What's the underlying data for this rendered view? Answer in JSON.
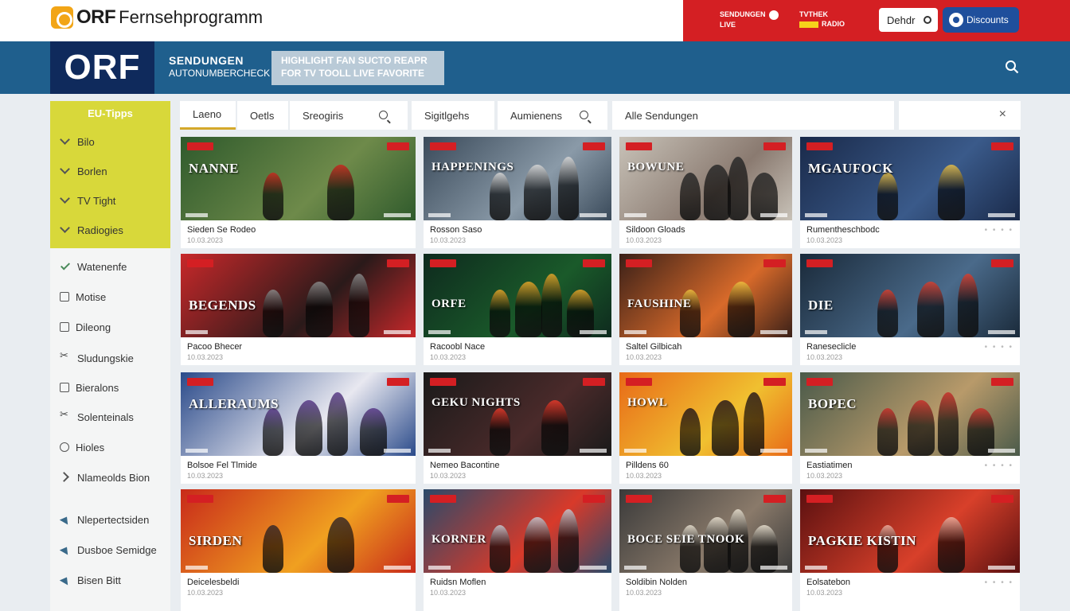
{
  "header": {
    "brand_short": "ORF",
    "brand_title": "Fernsehprogramm",
    "top_right": {
      "block_a": "SENDUNGEN",
      "block_a_sub": "LIVE",
      "block_b": "TVTHEK",
      "block_b_sub": "RADIO",
      "field_value": "Dehdr",
      "button_label": "Discounts"
    }
  },
  "banner": {
    "logo_text": "ORF",
    "line1": "SENDUNGEN",
    "line2": "AUTONUMBERCHECK",
    "highlight_line1": "HIGHLIGHT FAN SUCTO REAPR",
    "highlight_line2": "FOR TV TOOLL LIVE FAVORITE"
  },
  "sidebar": {
    "heading": "EU-Tipps",
    "items": [
      {
        "label": "Bilo",
        "icon": "chevron-down-icon"
      },
      {
        "label": "Borlen",
        "icon": "chevron-down-icon"
      },
      {
        "label": "TV Tight",
        "icon": "chevron-down-icon"
      },
      {
        "label": "Radiogies",
        "icon": "chevron-down-icon"
      },
      {
        "label": "Watenenfe",
        "icon": "check-icon"
      },
      {
        "label": "Motise",
        "icon": "square-icon"
      },
      {
        "label": "Dileong",
        "icon": "square-icon"
      },
      {
        "label": "Sludungskie",
        "icon": "scissors-icon"
      },
      {
        "label": "Bieralons",
        "icon": "square-icon"
      },
      {
        "label": "Solenteinals",
        "icon": "scissors-icon"
      },
      {
        "label": "Hioles",
        "icon": "refresh-icon"
      },
      {
        "label": "Nlameolds Bion",
        "icon": "chevron-right-icon"
      },
      {
        "label": "Nlepertectsiden",
        "icon": "triangle-icon"
      },
      {
        "label": "Dusboe Semidge",
        "icon": "triangle-icon"
      },
      {
        "label": "Bisen Bitt",
        "icon": "triangle-icon"
      }
    ]
  },
  "tabs": [
    {
      "label": "Laeno"
    },
    {
      "label": "Oetls"
    },
    {
      "label": "Sreogiris"
    },
    {
      "label": "Sigitlgehs"
    },
    {
      "label": "Aumienens"
    },
    {
      "label": "Alle Sendungen"
    },
    {
      "label": "×"
    }
  ],
  "cards": [
    {
      "title": "Sieden Se Rodeo",
      "date": "10.03.2023",
      "thumb_title": "NANNE"
    },
    {
      "title": "Rosson Saso",
      "date": "10.03.2023",
      "thumb_title": "HAPPENINGS"
    },
    {
      "title": "Sildoon Gloads",
      "date": "10.03.2023",
      "thumb_title": "BOWUNE"
    },
    {
      "title": "Rumentheschbodc",
      "date": "10.03.2023",
      "thumb_title": "MGAUFOCK"
    },
    {
      "title": "Pacoo Bhecer",
      "date": "10.03.2023",
      "thumb_title": "BEGENDS"
    },
    {
      "title": "Racoobl Nace",
      "date": "10.03.2023",
      "thumb_title": "ORFE"
    },
    {
      "title": "Saltel Gilbicah",
      "date": "10.03.2023",
      "thumb_title": "FAUSHINE"
    },
    {
      "title": "Raneseclicle",
      "date": "10.03.2023",
      "thumb_title": "DIE"
    },
    {
      "title": "Bolsoe Fel Tlmide",
      "date": "10.03.2023",
      "thumb_title": "ALLERAUMS"
    },
    {
      "title": "Nemeo Bacontine",
      "date": "10.03.2023",
      "thumb_title": "GEKU NIGHTS"
    },
    {
      "title": "Pilldens 60",
      "date": "10.03.2023",
      "thumb_title": "HOWL"
    },
    {
      "title": "Eastiatimen",
      "date": "10.03.2023",
      "thumb_title": "BOPEC"
    },
    {
      "title": "Deicelesbeldi",
      "date": "10.03.2023",
      "thumb_title": "SIRDEN"
    },
    {
      "title": "Ruidsn Moflen",
      "date": "10.03.2023",
      "thumb_title": "KORNER"
    },
    {
      "title": "Soldibin Nolden",
      "date": "10.03.2023",
      "thumb_title": "BOCE SEIE TNOOK"
    },
    {
      "title": "Eolsatebon",
      "date": "10.03.2023",
      "thumb_title": "PAGKIE KISTIN"
    }
  ],
  "colors": {
    "brand_red": "#d41f23",
    "banner_blue": "#1f5f8d",
    "logo_navy": "#0f2a5c",
    "sidebar_yellow": "#d8d83a",
    "button_blue": "#1f4f9c"
  }
}
